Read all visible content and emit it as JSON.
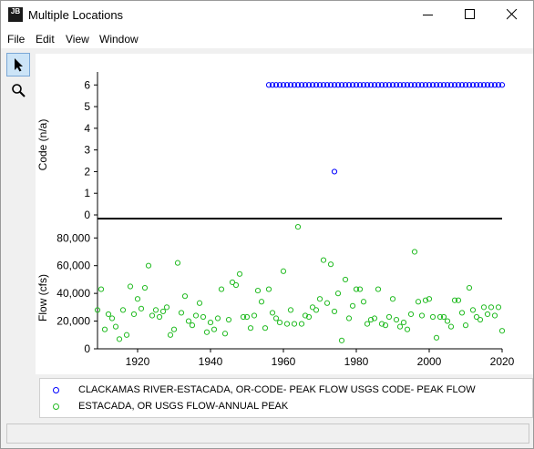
{
  "window": {
    "title": "Multiple Locations",
    "app_icon_text": "JB"
  },
  "menu": {
    "items": [
      {
        "label": "File"
      },
      {
        "label": "Edit"
      },
      {
        "label": "View"
      },
      {
        "label": "Window"
      }
    ]
  },
  "toolbar": {
    "tools": [
      {
        "icon": "pointer-arrow-icon",
        "active": true
      },
      {
        "icon": "magnifier-zoom-icon",
        "active": false
      }
    ]
  },
  "colors": {
    "code_series": "#0000ff",
    "flow_series": "#22bb22",
    "axis": "#000000"
  },
  "chart_data": [
    {
      "type": "scatter",
      "title": "",
      "xlabel": "",
      "ylabel": "Code (n/a)",
      "xlim": [
        1909,
        2020
      ],
      "ylim": [
        0,
        6.6
      ],
      "yticks": [
        0,
        1,
        2,
        3,
        4,
        5,
        6
      ],
      "grid": false,
      "series": [
        {
          "name": "CLACKAMAS RIVER-ESTACADA, OR-CODE- PEAK FLOW USGS CODE- PEAK FLOW",
          "x": [
            1956,
            1957,
            1958,
            1959,
            1960,
            1961,
            1962,
            1963,
            1964,
            1965,
            1966,
            1967,
            1968,
            1969,
            1970,
            1971,
            1972,
            1973,
            1974,
            1975,
            1976,
            1977,
            1978,
            1979,
            1980,
            1981,
            1982,
            1983,
            1984,
            1985,
            1986,
            1987,
            1988,
            1989,
            1990,
            1991,
            1992,
            1993,
            1994,
            1995,
            1996,
            1997,
            1998,
            1999,
            2000,
            2001,
            2002,
            2003,
            2004,
            2005,
            2006,
            2007,
            2008,
            2009,
            2010,
            2011,
            2012,
            2013,
            2014,
            2015,
            2016,
            2017,
            2018,
            2019,
            2020,
            1974
          ],
          "y": [
            6,
            6,
            6,
            6,
            6,
            6,
            6,
            6,
            6,
            6,
            6,
            6,
            6,
            6,
            6,
            6,
            6,
            6,
            6,
            6,
            6,
            6,
            6,
            6,
            6,
            6,
            6,
            6,
            6,
            6,
            6,
            6,
            6,
            6,
            6,
            6,
            6,
            6,
            6,
            6,
            6,
            6,
            6,
            6,
            6,
            6,
            6,
            6,
            6,
            6,
            6,
            6,
            6,
            6,
            6,
            6,
            6,
            6,
            6,
            6,
            6,
            6,
            6,
            6,
            6,
            2
          ]
        }
      ]
    },
    {
      "type": "scatter",
      "title": "",
      "xlabel": "",
      "ylabel": "Flow (cfs)",
      "xlim": [
        1909,
        2020
      ],
      "ylim": [
        0,
        92000
      ],
      "yticks": [
        0,
        20000,
        40000,
        60000,
        80000
      ],
      "ytick_labels": [
        "0",
        "20,000",
        "40,000",
        "60,000",
        "80,000"
      ],
      "xticks": [
        1920,
        1940,
        1960,
        1980,
        2000,
        2020
      ],
      "xtick_labels": [
        "1920",
        "1940",
        "1960",
        "1980",
        "2000",
        "2020"
      ],
      "grid": false,
      "series": [
        {
          "name": "ESTACADA, OR USGS FLOW-ANNUAL PEAK",
          "x": [
            1909,
            1910,
            1911,
            1912,
            1913,
            1914,
            1915,
            1916,
            1917,
            1918,
            1919,
            1920,
            1921,
            1922,
            1923,
            1924,
            1925,
            1926,
            1927,
            1928,
            1929,
            1930,
            1931,
            1932,
            1933,
            1934,
            1935,
            1936,
            1937,
            1938,
            1939,
            1940,
            1941,
            1942,
            1943,
            1944,
            1945,
            1946,
            1947,
            1948,
            1949,
            1950,
            1951,
            1952,
            1953,
            1954,
            1955,
            1956,
            1957,
            1958,
            1959,
            1960,
            1961,
            1962,
            1963,
            1964,
            1965,
            1966,
            1967,
            1968,
            1969,
            1970,
            1971,
            1972,
            1973,
            1974,
            1975,
            1976,
            1977,
            1978,
            1979,
            1980,
            1981,
            1982,
            1983,
            1984,
            1985,
            1986,
            1987,
            1988,
            1989,
            1990,
            1991,
            1992,
            1993,
            1994,
            1995,
            1996,
            1997,
            1998,
            1999,
            2000,
            2001,
            2002,
            2003,
            2004,
            2005,
            2006,
            2007,
            2008,
            2009,
            2010,
            2011,
            2012,
            2013,
            2014,
            2015,
            2016,
            2017,
            2018,
            2019,
            2020
          ],
          "y": [
            28000,
            43000,
            14000,
            25000,
            22000,
            16000,
            7000,
            28000,
            10000,
            45000,
            25000,
            36000,
            29000,
            44000,
            60000,
            24000,
            28000,
            23000,
            27000,
            30000,
            10000,
            14000,
            62000,
            26000,
            38000,
            20000,
            17000,
            24000,
            33000,
            23000,
            12000,
            19000,
            14000,
            22000,
            43000,
            11000,
            21000,
            48000,
            46000,
            54000,
            23000,
            23000,
            15000,
            24000,
            42000,
            34000,
            15000,
            43000,
            26000,
            22000,
            19000,
            56000,
            18000,
            28000,
            18000,
            88000,
            18000,
            24000,
            23000,
            30000,
            28000,
            36000,
            64000,
            33000,
            61000,
            27000,
            40000,
            6000,
            50000,
            22000,
            31000,
            43000,
            43000,
            34000,
            18000,
            21000,
            22000,
            43000,
            18000,
            17000,
            23000,
            36000,
            21000,
            16000,
            19000,
            14000,
            25000,
            70000,
            34000,
            24000,
            35000,
            36000,
            23000,
            8000,
            23000,
            23000,
            20000,
            16000,
            35000,
            35000,
            26000,
            17000,
            44000,
            28000,
            23000,
            21000,
            30000,
            25000,
            30000,
            24000,
            30000,
            13000
          ]
        }
      ]
    }
  ],
  "legend": {
    "entries": [
      {
        "label": "CLACKAMAS RIVER-ESTACADA, OR-CODE- PEAK FLOW USGS CODE- PEAK FLOW",
        "color": "#0000ff"
      },
      {
        "label": "ESTACADA, OR USGS FLOW-ANNUAL PEAK",
        "color": "#22bb22"
      }
    ]
  },
  "status": {
    "text": ""
  }
}
